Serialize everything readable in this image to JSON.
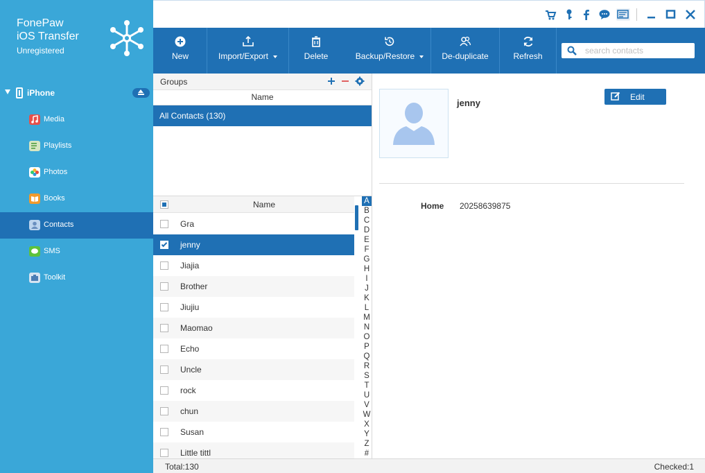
{
  "app": {
    "name_line1": "FonePaw",
    "name_line2": "iOS Transfer",
    "status": "Unregistered"
  },
  "colors": {
    "sidebar": "#3aa7d8",
    "accent": "#1f70b4"
  },
  "device": {
    "name": "iPhone"
  },
  "nav": [
    {
      "label": "Media",
      "icon": "music-icon"
    },
    {
      "label": "Playlists",
      "icon": "playlist-icon"
    },
    {
      "label": "Photos",
      "icon": "photos-icon"
    },
    {
      "label": "Books",
      "icon": "books-icon"
    },
    {
      "label": "Contacts",
      "icon": "contacts-icon",
      "active": true
    },
    {
      "label": "SMS",
      "icon": "sms-icon"
    },
    {
      "label": "Toolkit",
      "icon": "toolkit-icon"
    }
  ],
  "topbar_icons": [
    "cart-icon",
    "key-icon",
    "facebook-icon",
    "chat-icon",
    "feedback-icon",
    "minimize-icon",
    "maximize-icon",
    "close-icon"
  ],
  "toolbar": {
    "new_label": "New",
    "import_export_label": "Import/Export",
    "delete_label": "Delete",
    "backup_restore_label": "Backup/Restore",
    "deduplicate_label": "De-duplicate",
    "refresh_label": "Refresh"
  },
  "search": {
    "placeholder": "search contacts",
    "value": ""
  },
  "groups": {
    "title": "Groups",
    "column": "Name",
    "items": [
      {
        "label": "All Contacts  (130)"
      }
    ]
  },
  "contacts": {
    "column": "Name",
    "rows": [
      {
        "name": "Gra",
        "checked": false
      },
      {
        "name": "jenny",
        "checked": true
      },
      {
        "name": "Jiajia",
        "checked": false
      },
      {
        "name": "Brother",
        "checked": false
      },
      {
        "name": "Jiujiu",
        "checked": false
      },
      {
        "name": "Maomao",
        "checked": false
      },
      {
        "name": "Echo",
        "checked": false
      },
      {
        "name": "Uncle",
        "checked": false
      },
      {
        "name": "rock",
        "checked": false
      },
      {
        "name": "chun",
        "checked": false
      },
      {
        "name": "Susan",
        "checked": false
      },
      {
        "name": "Little tittl",
        "checked": false
      }
    ],
    "alphabet": [
      "A",
      "B",
      "C",
      "D",
      "E",
      "F",
      "G",
      "H",
      "I",
      "J",
      "K",
      "L",
      "M",
      "N",
      "O",
      "P",
      "Q",
      "R",
      "S",
      "T",
      "U",
      "V",
      "W",
      "X",
      "Y",
      "Z",
      "#"
    ],
    "alphabet_active": "A"
  },
  "detail": {
    "name": "jenny",
    "edit_label": "Edit",
    "field_label": "Home",
    "field_value": "20258639875"
  },
  "status": {
    "total": "Total:130",
    "checked": "Checked:1"
  }
}
